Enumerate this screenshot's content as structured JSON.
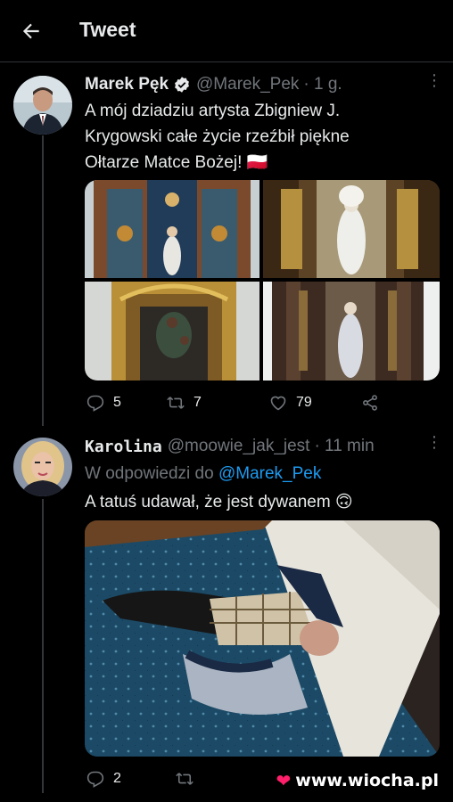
{
  "header": {
    "title": "Tweet"
  },
  "tweet1": {
    "name": "Marek Pęk",
    "handle": "@Marek_Pek",
    "time": "· 1 g.",
    "lines": [
      "A mój dziadziu artysta Zbigniew J.",
      "Krygowski całe życie rzeźbił piękne",
      "Ołtarze Matce Bożej! 🇵🇱"
    ],
    "replies": "5",
    "retweets": "7",
    "likes": "79"
  },
  "tweet2": {
    "name": "Karolina",
    "handle": "@moowie_jak_jest",
    "time": "· 11 min",
    "reply_prefix": "W odpowiedzi do",
    "reply_to": "@Marek_Pek",
    "text": "A tatuś udawał, że jest dywanem 🙃",
    "replies": "2"
  },
  "watermark": {
    "text": "www.wiocha.pl"
  },
  "colors": {
    "accent": "#1d9bf0",
    "muted": "#71767b",
    "background": "#000000"
  }
}
